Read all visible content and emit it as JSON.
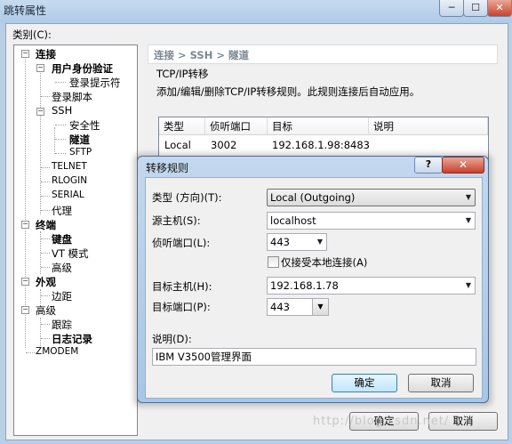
{
  "window": {
    "title": "跳转属性",
    "minimize": "─",
    "maximize": "☐",
    "close": "✕",
    "category_label": "类别(C):",
    "ok_label": "确定",
    "cancel_label": "取消"
  },
  "tree": {
    "items": [
      {
        "label": "连接"
      },
      {
        "label": "用户身份验证"
      },
      {
        "label": "登录提示符"
      },
      {
        "label": "登录脚本"
      },
      {
        "label": "SSH"
      },
      {
        "label": "安全性"
      },
      {
        "label": "隧道"
      },
      {
        "label": "SFTP"
      },
      {
        "label": "TELNET"
      },
      {
        "label": "RLOGIN"
      },
      {
        "label": "SERIAL"
      },
      {
        "label": "代理"
      },
      {
        "label": "终端"
      },
      {
        "label": "键盘"
      },
      {
        "label": "VT 模式"
      },
      {
        "label": "高级"
      },
      {
        "label": "外观"
      },
      {
        "label": "边距"
      },
      {
        "label": "高级"
      },
      {
        "label": "跟踪"
      },
      {
        "label": "日志记录"
      },
      {
        "label": "ZMODEM"
      }
    ]
  },
  "breadcrumb": "连接 > SSH > 隧道",
  "section": {
    "legend": "TCP/IP转移",
    "description": "添加/编辑/删除TCP/IP转移规则。此规则连接后自动应用。"
  },
  "table": {
    "columns": [
      "类型",
      "侦听端口",
      "目标",
      "说明"
    ],
    "rows": [
      {
        "type": "Local",
        "port": "3002",
        "target": "192.168.1.98:8483",
        "note": ""
      }
    ]
  },
  "dialog": {
    "title": "转移规则",
    "help": "?",
    "close": "✕",
    "type_label": "类型 (方向)(T):",
    "type_value": "Local (Outgoing)",
    "source_host_label": "源主机(S):",
    "source_host_value": "localhost",
    "listen_port_label": "侦听端口(L):",
    "listen_port_value": "443",
    "local_only_label": "仅接受本地连接(A)",
    "target_host_label": "目标主机(H):",
    "target_host_value": "192.168.1.78",
    "target_port_label": "目标端口(P):",
    "target_port_value": "443",
    "description_label": "说明(D):",
    "description_value": "IBM V3500管理界面",
    "ok_label": "确定",
    "cancel_label": "取消"
  },
  "watermark": "http://blog.csdn.net/"
}
